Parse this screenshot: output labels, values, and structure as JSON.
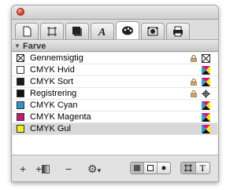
{
  "panel": {
    "section_title": "Farve",
    "tabs": [
      {
        "name": "page-tab"
      },
      {
        "name": "frame-tab"
      },
      {
        "name": "shadow-tab"
      },
      {
        "name": "text-style-tab"
      },
      {
        "name": "color-tab"
      },
      {
        "name": "picture-tab"
      },
      {
        "name": "print-tab"
      }
    ],
    "active_tab": "color-tab"
  },
  "colors": [
    {
      "label": "Gennemsigtig",
      "swatch": "none",
      "locked": true,
      "mode": "none"
    },
    {
      "label": "CMYK Hvid",
      "swatch": "#ffffff",
      "locked": false,
      "mode": "cmyk"
    },
    {
      "label": "CMYK Sort",
      "swatch": "#1a1a1a",
      "locked": true,
      "mode": "cmyk"
    },
    {
      "label": "Registrering",
      "swatch": "#111111",
      "locked": true,
      "mode": "registration"
    },
    {
      "label": "CMYK Cyan",
      "swatch": "#2f93c9",
      "locked": false,
      "mode": "cmyk"
    },
    {
      "label": "CMYK Magenta",
      "swatch": "#c21a72",
      "locked": false,
      "mode": "cmyk"
    },
    {
      "label": "CMYK Gul",
      "swatch": "#f4ee1a",
      "locked": false,
      "mode": "cmyk",
      "selected": true
    }
  ],
  "bottom_toolbar": {
    "add": "+",
    "add_gradient": "+",
    "remove": "−",
    "gear": "⚙",
    "dropdown": "▾",
    "text_target": "T"
  }
}
